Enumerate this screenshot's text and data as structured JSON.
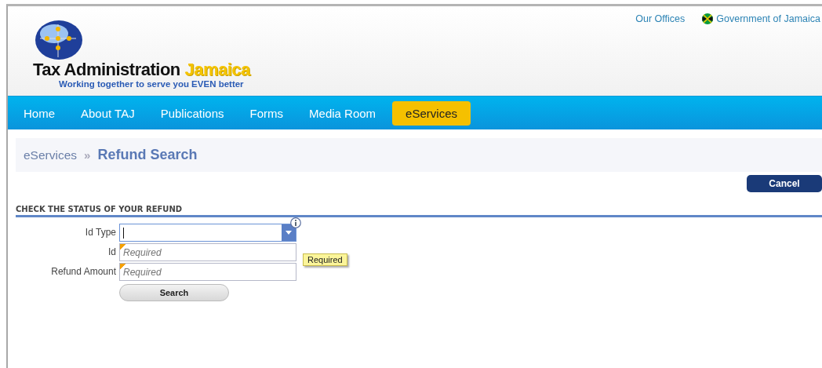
{
  "header": {
    "links": [
      {
        "label": "Our Offices",
        "kind": "text"
      },
      {
        "label": "Government of Jamaica",
        "kind": "flag"
      }
    ],
    "logo": {
      "name": "Tax Administration",
      "accent": "Jamaica",
      "tagline": "Working together to serve you EVEN better"
    }
  },
  "nav": [
    {
      "label": "Home",
      "selected": false
    },
    {
      "label": "About TAJ",
      "selected": false
    },
    {
      "label": "Publications",
      "selected": false
    },
    {
      "label": "Forms",
      "selected": false
    },
    {
      "label": "Media Room",
      "selected": false
    },
    {
      "label": "eServices",
      "selected": true
    }
  ],
  "breadcrumb": {
    "parent": "eServices",
    "separator": "»",
    "current": "Refund Search"
  },
  "cancel_button": "Cancel",
  "section_title": "CHECK THE STATUS OF YOUR REFUND",
  "fields": [
    {
      "label": "Id Type",
      "kind": "select",
      "focused": true,
      "required": false
    },
    {
      "label": "Id",
      "kind": "text",
      "placeholder": "Required",
      "focused": false,
      "required": true,
      "tooltip": "Required"
    },
    {
      "label": "Refund Amount",
      "kind": "text",
      "placeholder": "Required",
      "focused": false,
      "required": true
    }
  ],
  "search_button": "Search"
}
